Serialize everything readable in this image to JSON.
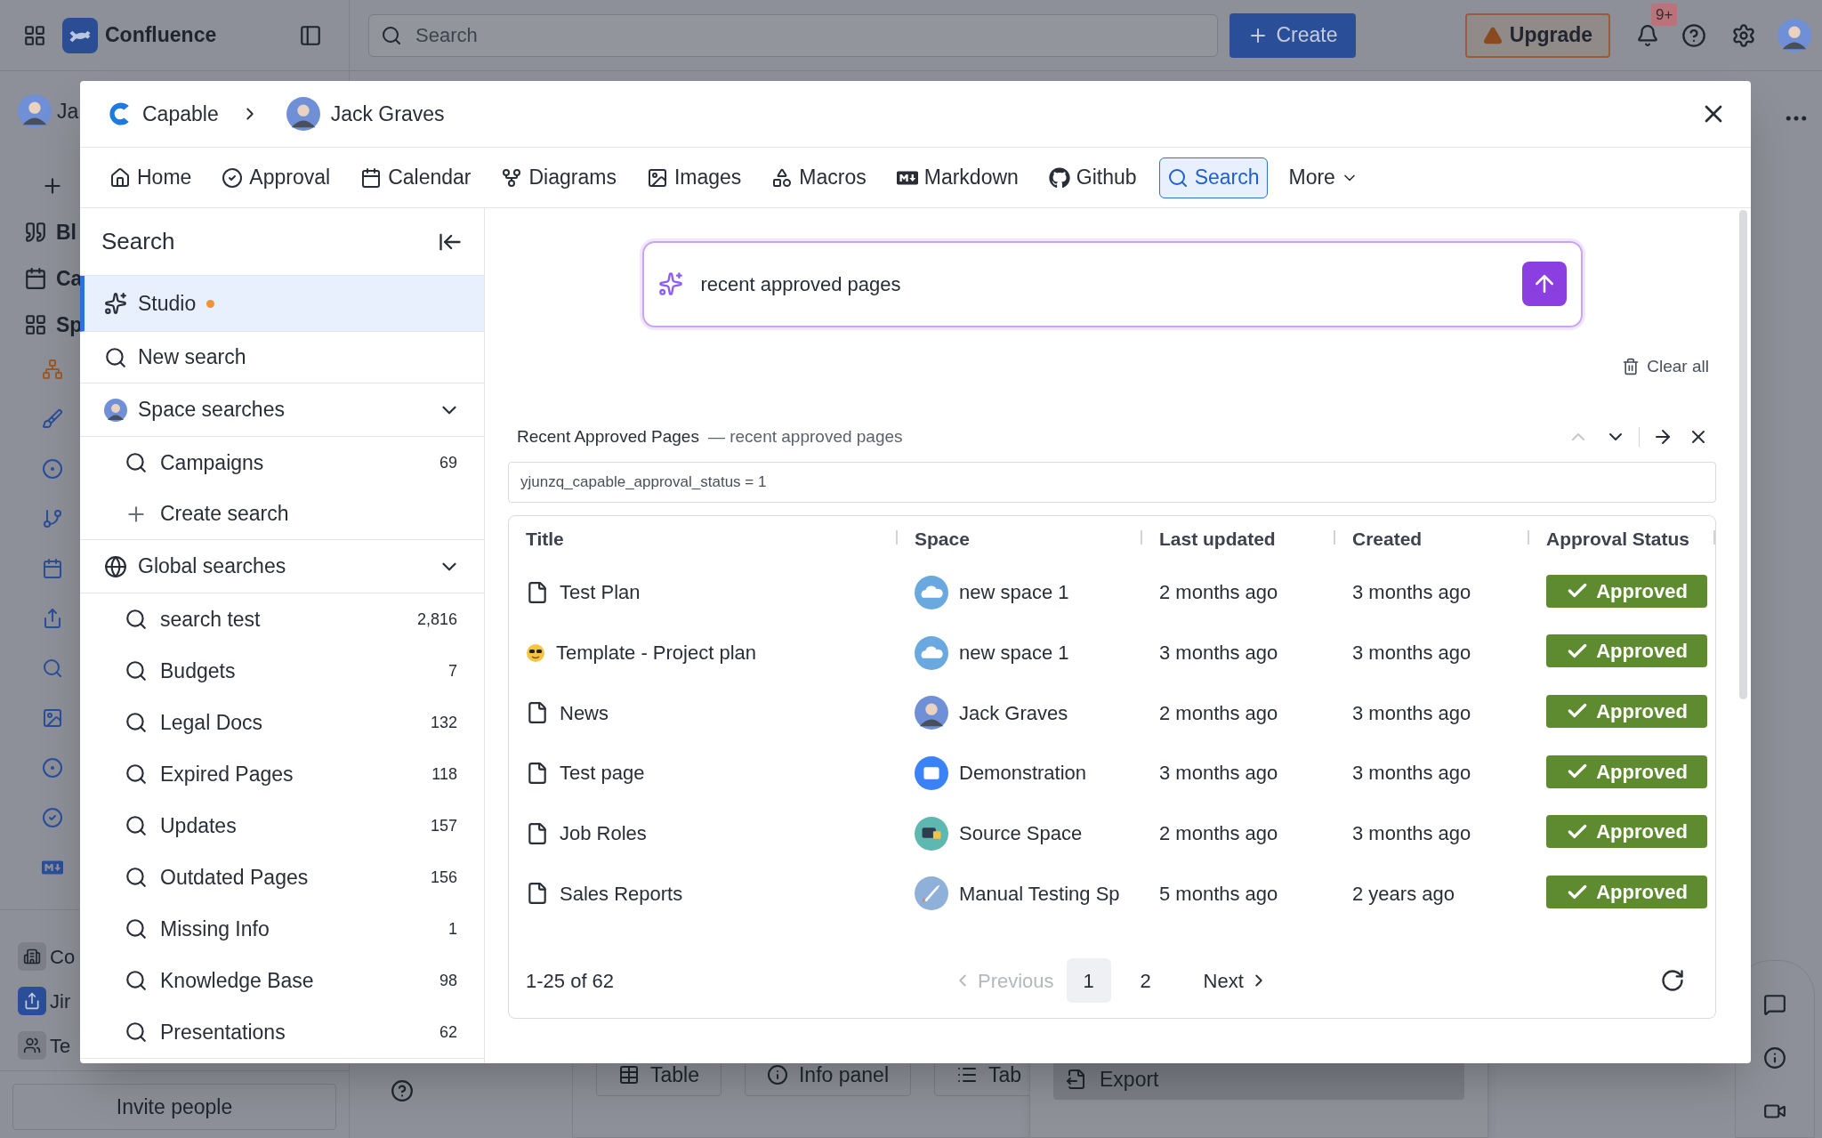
{
  "topbar": {
    "product": "Confluence",
    "search": {
      "placeholder": "Search"
    },
    "create": "Create",
    "upgrade": "Upgrade",
    "notifications": "9+"
  },
  "sidebar": {
    "user": "Ja",
    "items": [
      {
        "kind": "create"
      },
      {
        "kind": "quote",
        "label": "Bl"
      },
      {
        "kind": "calendar",
        "label": "Ca"
      },
      {
        "kind": "apps",
        "label": "Sp"
      }
    ],
    "apps": [
      {
        "kind": "hierarchy"
      },
      {
        "kind": "brush"
      },
      {
        "kind": "traffic"
      },
      {
        "kind": "branch"
      },
      {
        "kind": "calendar"
      },
      {
        "kind": "share"
      },
      {
        "kind": "search"
      },
      {
        "kind": "image"
      },
      {
        "kind": "capable"
      },
      {
        "kind": "check"
      },
      {
        "kind": "markdown"
      }
    ],
    "footer": [
      {
        "kind": "building",
        "label": "Co"
      },
      {
        "kind": "jira",
        "label": "Jir"
      },
      {
        "kind": "people",
        "label": "Te"
      }
    ],
    "invite": "Invite people"
  },
  "page": {
    "toolbar": [
      {
        "kind": "table",
        "label": "Table"
      },
      {
        "kind": "info",
        "label": "Info panel"
      },
      {
        "kind": "list",
        "label": "Tab"
      }
    ],
    "menu": [
      {
        "label": "Export",
        "selected": true
      }
    ]
  },
  "modal": {
    "breadcrumb": [
      "Capable",
      "Jack Graves"
    ],
    "tabs": [
      {
        "kind": "home",
        "label": "Home",
        "selected": false
      },
      {
        "kind": "approval",
        "label": "Approval",
        "selected": false
      },
      {
        "kind": "calendar",
        "label": "Calendar",
        "selected": false
      },
      {
        "kind": "diagrams",
        "label": "Diagrams",
        "selected": false
      },
      {
        "kind": "images",
        "label": "Images",
        "selected": false
      },
      {
        "kind": "macros",
        "label": "Macros",
        "selected": false
      },
      {
        "kind": "markdown",
        "label": "Markdown",
        "selected": false
      },
      {
        "kind": "github",
        "label": "Github",
        "selected": false
      },
      {
        "kind": "search",
        "label": "Search",
        "selected": true
      }
    ],
    "more": "More",
    "panel": {
      "title": "Search",
      "studio": {
        "label": "Studio",
        "selected": true,
        "unread": true
      },
      "new_search": "New search",
      "groups": [
        {
          "kind": "space",
          "label": "Space searches",
          "expanded": true,
          "items": [
            {
              "label": "Campaigns",
              "count": "69"
            }
          ],
          "create": "Create search"
        },
        {
          "kind": "global",
          "label": "Global searches",
          "expanded": true,
          "items": [
            {
              "label": "search test",
              "count": "2,816"
            },
            {
              "label": "Budgets",
              "count": "7"
            },
            {
              "label": "Legal Docs",
              "count": "132"
            },
            {
              "label": "Expired Pages",
              "count": "118"
            },
            {
              "label": "Updates",
              "count": "157"
            },
            {
              "label": "Outdated Pages",
              "count": "156"
            },
            {
              "label": "Missing Info",
              "count": "1"
            },
            {
              "label": "Knowledge Base",
              "count": "98"
            },
            {
              "label": "Presentations",
              "count": "62"
            }
          ]
        }
      ]
    },
    "prompt": {
      "value": "recent approved pages"
    },
    "clear_all": "Clear all",
    "result": {
      "title": "Recent Approved Pages",
      "subtitle": "— recent approved pages",
      "filter": "yjunzq_capable_approval_status = 1",
      "columns": [
        "Title",
        "Space",
        "Last updated",
        "Created",
        "Approval Status"
      ],
      "rows": [
        {
          "kind": "page",
          "title": "Test Plan",
          "space": {
            "kind": "cloud",
            "name": "new space 1"
          },
          "updated": "2 months ago",
          "created": "3 months ago",
          "status": "Approved"
        },
        {
          "kind": "emoji",
          "title": "Template - Project plan",
          "space": {
            "kind": "cloud",
            "name": "new space 1"
          },
          "updated": "3 months ago",
          "created": "3 months ago",
          "status": "Approved"
        },
        {
          "kind": "page",
          "title": "News",
          "space": {
            "kind": "person",
            "name": "Jack Graves"
          },
          "updated": "2 months ago",
          "created": "3 months ago",
          "status": "Approved"
        },
        {
          "kind": "page",
          "title": "Test page",
          "space": {
            "kind": "folder",
            "name": "Demonstration"
          },
          "updated": "3 months ago",
          "created": "3 months ago",
          "status": "Approved"
        },
        {
          "kind": "page",
          "title": "Job Roles",
          "space": {
            "kind": "card",
            "name": "Source Space"
          },
          "updated": "2 months ago",
          "created": "3 months ago",
          "status": "Approved"
        },
        {
          "kind": "page",
          "title": "Sales Reports",
          "space": {
            "kind": "rocket",
            "name": "Manual Testing Sp"
          },
          "updated": "5 months ago",
          "created": "2 years ago",
          "status": "Approved"
        }
      ],
      "pagination": {
        "range": "1-25 of 62",
        "previous": {
          "label": "Previous",
          "disabled": true
        },
        "pages": [
          {
            "label": "1",
            "selected": true
          },
          {
            "label": "2",
            "selected": false
          }
        ],
        "next": "Next"
      }
    }
  }
}
